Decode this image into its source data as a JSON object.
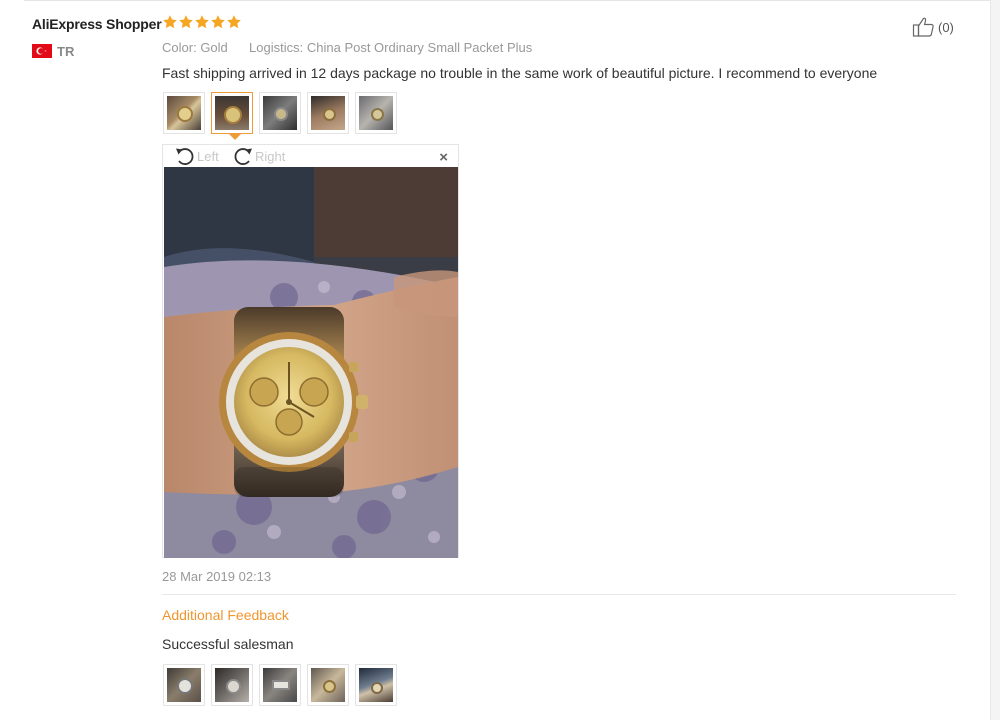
{
  "review": {
    "user_name": "AliExpress Shopper",
    "rating": 5,
    "country": "TR",
    "color_label": "Color:",
    "color_value": "Gold",
    "logistics_label": "Logistics:",
    "logistics_value": "China Post Ordinary Small Packet Plus",
    "text": "Fast shipping arrived in 12 days package no trouble in the same work of beautiful picture. I recommend to everyone",
    "helpful_count": "(0)",
    "date": "28 Mar 2019 02:13",
    "thumbnails": [
      "photo-1",
      "photo-2",
      "photo-3",
      "photo-4",
      "photo-5"
    ],
    "active_thumbnail": 1
  },
  "viewer": {
    "rotate_left_label": "Left",
    "rotate_right_label": "Right",
    "close_label": "×"
  },
  "additional": {
    "title": "Additional Feedback",
    "text": "Successful salesman",
    "thumbnails": [
      "photo-6",
      "photo-7",
      "photo-8",
      "photo-9",
      "photo-10"
    ]
  },
  "colors": {
    "star": "#f5a623",
    "accent": "#f0962f",
    "flag_red": "#e30a17"
  },
  "icons": {
    "rating": "star-icon",
    "helpful": "thumbs-up-icon",
    "rotate_left": "rotate-left-icon",
    "rotate_right": "rotate-right-icon",
    "close": "close-icon",
    "flag": "turkey-flag-icon"
  }
}
